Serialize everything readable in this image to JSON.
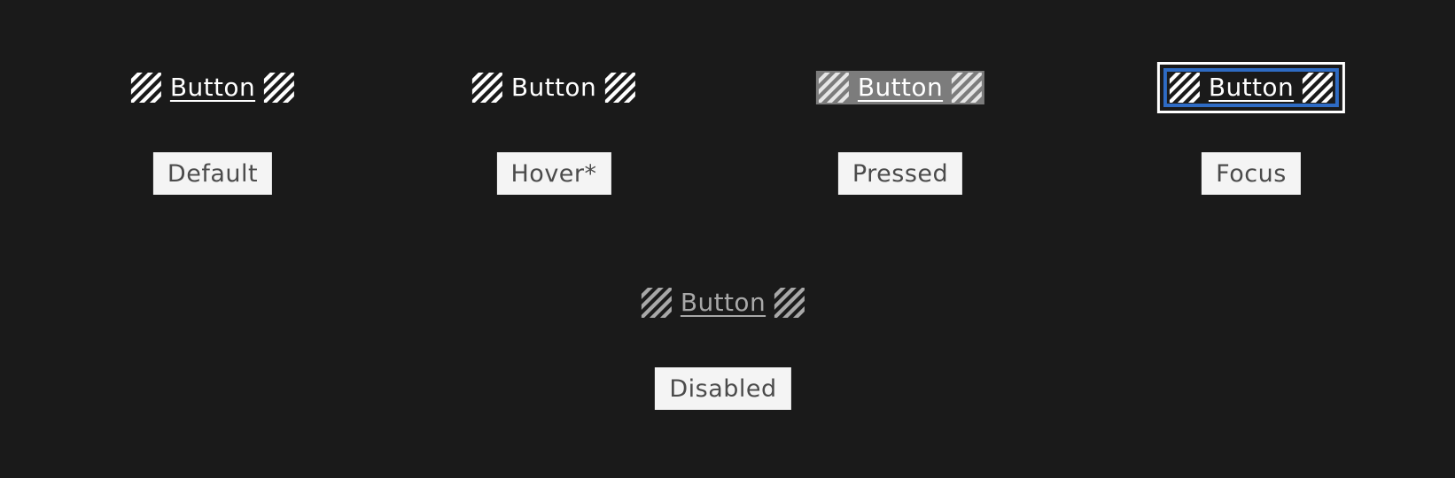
{
  "colors": {
    "background": "#1a1a1a",
    "label_text": "#ffffff",
    "pressed_fill": "#7c7c7c",
    "focus_ring_outer": "#ffffff",
    "focus_ring_inner": "#2e6bc4",
    "disabled_text": "#a8a8a8",
    "tag_background": "#f4f4f4",
    "tag_text": "#4b4b4b"
  },
  "variants": [
    {
      "id": "default",
      "button_label": "Button",
      "state_label": "Default",
      "icon": "hatch-icon"
    },
    {
      "id": "hover",
      "button_label": "Button",
      "state_label": "Hover*",
      "icon": "hatch-icon"
    },
    {
      "id": "pressed",
      "button_label": "Button",
      "state_label": "Pressed",
      "icon": "hatch-icon"
    },
    {
      "id": "focus",
      "button_label": "Button",
      "state_label": "Focus",
      "icon": "hatch-icon"
    },
    {
      "id": "disabled",
      "button_label": "Button",
      "state_label": "Disabled",
      "icon": "hatch-icon"
    }
  ]
}
